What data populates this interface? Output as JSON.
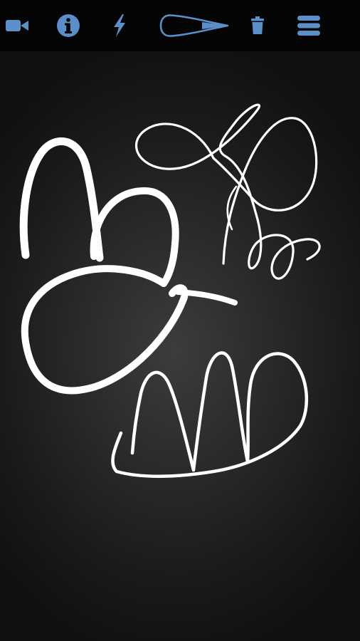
{
  "toolbar": {
    "accent_color": "#5b8fc9",
    "background_color": "#050505",
    "icons": [
      "video-camera-icon",
      "info-icon",
      "lightning-icon",
      "brush-stroke-icon",
      "trash-icon",
      "menu-icon"
    ]
  },
  "canvas": {
    "stroke_color": "#ffffff",
    "strokes": [
      "brush-letter-b",
      "calligraphic-loop-flourish",
      "wave-arches-stroke"
    ]
  }
}
